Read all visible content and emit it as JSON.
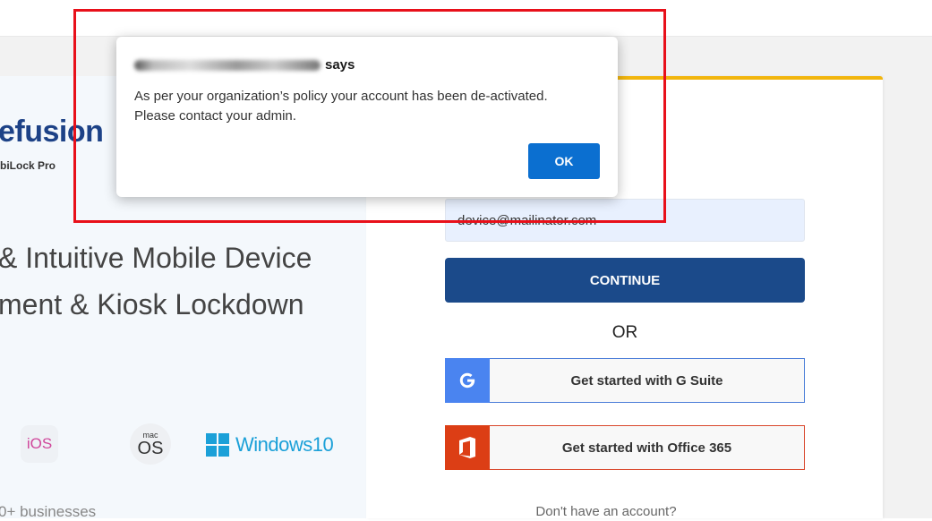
{
  "left": {
    "brand": "efusion",
    "brand_sub": "biLock Pro",
    "headline_1": "& Intuitive Mobile Device",
    "headline_2": "ment & Kiosk Lockdown",
    "os_ios": "iOS",
    "os_mac_small": "mac",
    "os_mac_big": "OS",
    "os_windows": "Windows10",
    "businesses": "0+ businesses"
  },
  "login": {
    "email_value": "device@mailinator.com",
    "continue_label": "CONTINUE",
    "or_label": "OR",
    "google_label": "Get started with G Suite",
    "office_label": "Get started with Office 365",
    "signup_text": "Don't have an account?"
  },
  "dialog": {
    "title_suffix": "says",
    "message_line_1": "As per your organization’s policy your account has been de-activated.",
    "message_line_2": "Please contact your admin.",
    "ok_label": "OK"
  },
  "icons": {
    "google": "google-g-icon",
    "office": "office-365-icon",
    "windows": "windows-logo-icon"
  },
  "colors": {
    "brand_blue": "#1d4287",
    "continue_bg": "#1b4a8a",
    "card_accent": "#f2b60e",
    "google_blue": "#4a84f0",
    "office_red": "#dc3e15",
    "ok_blue": "#0b6fd0",
    "highlight_red": "#e8101a"
  }
}
